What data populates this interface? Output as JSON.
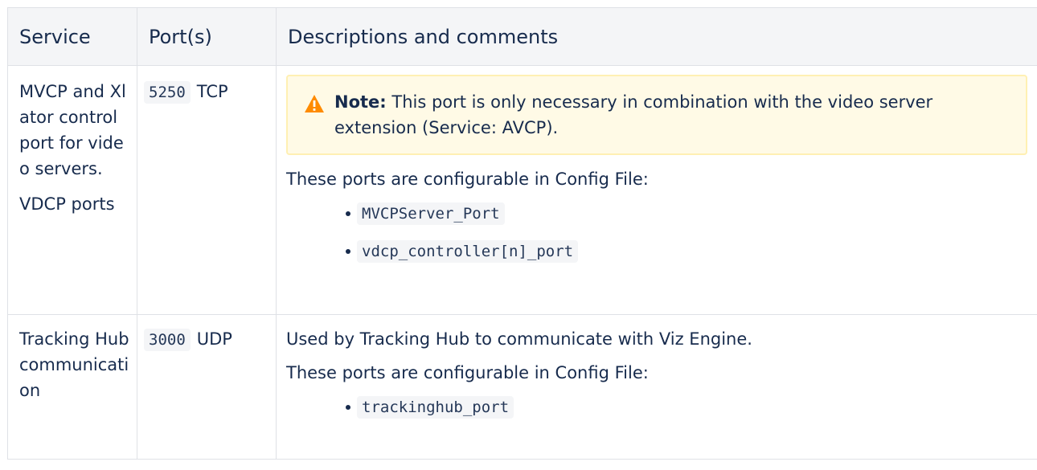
{
  "table": {
    "headers": {
      "service": "Service",
      "ports": "Port(s)",
      "description": "Descriptions and comments"
    },
    "rows": [
      {
        "service_lines": [
          "MVCP and Xlator control port for video servers.",
          "VDCP ports"
        ],
        "port_number": "5250",
        "port_protocol": "TCP",
        "note_label": "Note:",
        "note_text": " This port is only necessary in combination with the video server extension (Service: AVCP).",
        "description": "These ports are configurable in Config File:",
        "config_keys": [
          "MVCPServer_Port",
          "vdcp_controller[n]_port"
        ]
      },
      {
        "service_lines": [
          "Tracking Hub communication"
        ],
        "port_number": "3000",
        "port_protocol": "UDP",
        "description_intro": "Used by Tracking Hub to communicate with Viz Engine.",
        "description": "These ports are configurable in Config File:",
        "config_keys": [
          "trackinghub_port"
        ]
      }
    ]
  },
  "colors": {
    "text": "#172b4d",
    "header_bg": "#f4f5f7",
    "border": "#dfe1e6",
    "note_bg": "#fffae6",
    "note_border": "#fff0b3",
    "warning_icon": "#ff8b00",
    "code_bg": "#f4f5f7"
  },
  "icons": {
    "note": "warning-triangle-icon"
  }
}
